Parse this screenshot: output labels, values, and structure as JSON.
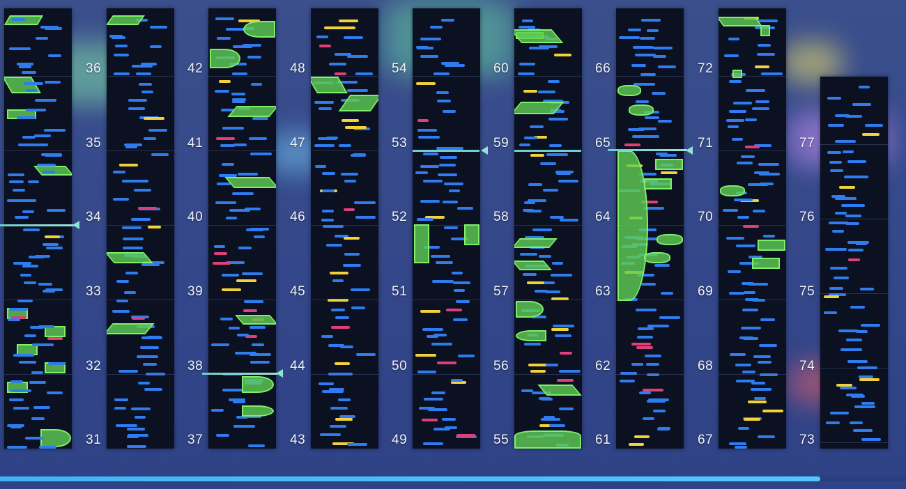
{
  "progress": {
    "fraction": 0.905
  },
  "colors": {
    "tap": "#2f7cf0",
    "drag": "#f2d23a",
    "flick": "#e0407a",
    "slider": "#7ef06a"
  },
  "columns": [
    {
      "labels": [
        "36",
        "35",
        "34",
        "33",
        "32",
        "31"
      ]
    },
    {
      "labels": [
        "42",
        "41",
        "40",
        "39",
        "38",
        "37"
      ]
    },
    {
      "labels": [
        "48",
        "47",
        "46",
        "45",
        "44",
        "43"
      ]
    },
    {
      "labels": [
        "54",
        "53",
        "52",
        "51",
        "50",
        "49"
      ]
    },
    {
      "labels": [
        "60",
        "59",
        "58",
        "57",
        "56",
        "55"
      ]
    },
    {
      "labels": [
        "66",
        "65",
        "64",
        "63",
        "62",
        "61"
      ]
    },
    {
      "labels": [
        "72",
        "71",
        "70",
        "69",
        "68",
        "67"
      ]
    },
    {
      "labels": [
        "77",
        "76",
        "75",
        "74",
        "73"
      ]
    }
  ]
}
